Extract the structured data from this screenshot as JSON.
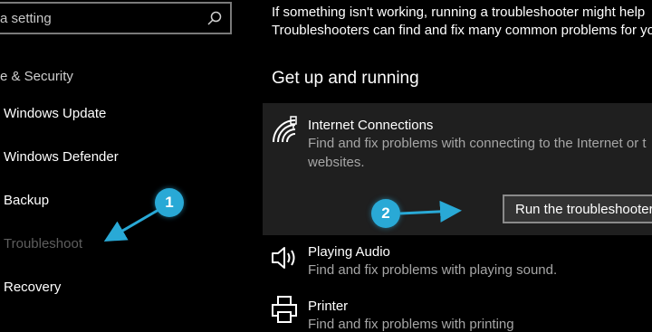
{
  "sidebar": {
    "search_placeholder": "a setting",
    "section_label": "e & Security",
    "items": [
      {
        "label": "Windows Update"
      },
      {
        "label": "Windows Defender"
      },
      {
        "label": "Backup"
      },
      {
        "label": "Troubleshoot"
      },
      {
        "label": "Recovery"
      }
    ]
  },
  "main": {
    "intro_line1": "If something isn't working, running a troubleshooter might help",
    "intro_line2": "Troubleshooters can find and fix many common problems for yo",
    "section_title": "Get up and running",
    "items": [
      {
        "title": "Internet Connections",
        "desc_line1": "Find and fix problems with connecting to the Internet or t",
        "desc_line2": "websites.",
        "icon": "wifi-icon"
      },
      {
        "title": "Playing Audio",
        "desc_line1": "Find and fix problems with playing sound.",
        "icon": "speaker-icon"
      },
      {
        "title": "Printer",
        "desc_line1": "Find and fix problems with printing",
        "icon": "printer-icon"
      }
    ],
    "run_button": "Run the troubleshooter"
  },
  "annotations": {
    "badge1": "1",
    "badge2": "2"
  },
  "colors": {
    "background": "#000000",
    "selected_card": "#1f1f1f",
    "annotation_blue": "#29a9d6",
    "dim_text": "#5e5e5e"
  }
}
